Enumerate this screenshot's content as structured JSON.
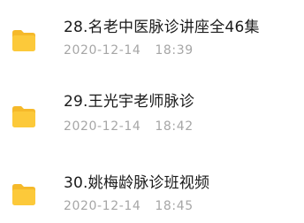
{
  "files": [
    {
      "name": "28.名老中医脉诊讲座全46集",
      "date": "2020-12-14",
      "time": "18:39",
      "icon": "folder-icon"
    },
    {
      "name": "29.王光宇老师脉诊",
      "date": "2020-12-14",
      "time": "18:42",
      "icon": "folder-icon"
    },
    {
      "name": "30.姚梅龄脉诊班视频",
      "date": "2020-12-14",
      "time": "18:45",
      "icon": "folder-icon"
    }
  ],
  "colors": {
    "folder": "#FCC93A",
    "folder_tab": "#F5B92A",
    "name_text": "#1a1a1a",
    "meta_text": "#a6a6a6"
  }
}
